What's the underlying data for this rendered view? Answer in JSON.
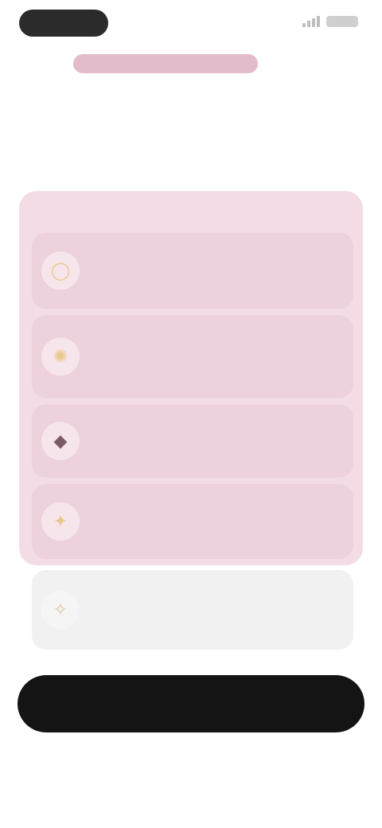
{
  "status_bar": {
    "signal_icon": "signal-icon",
    "battery_icon": "battery-icon"
  },
  "header": {
    "progress_icon": "progress-bar"
  },
  "prompt": {
    "title": ""
  },
  "panel": {
    "caption": ""
  },
  "options": [
    {
      "icon": "circle-icon",
      "glyph": "◯",
      "title": "",
      "description": ""
    },
    {
      "icon": "sun-icon",
      "glyph": "✺",
      "title": "",
      "description": ""
    },
    {
      "icon": "drop-icon",
      "glyph": "◆",
      "title": "",
      "description": ""
    },
    {
      "icon": "star-icon",
      "glyph": "✦",
      "title": "",
      "description": ""
    },
    {
      "icon": "leaf-icon",
      "glyph": "✧",
      "title": "",
      "description": ""
    }
  ],
  "actions": {
    "continue_label": "",
    "skip_label": ""
  },
  "colors": {
    "accent": "#e2bccb",
    "panel": "#f3dce5",
    "selected_option": "#edd1dc",
    "button": "#141414"
  }
}
